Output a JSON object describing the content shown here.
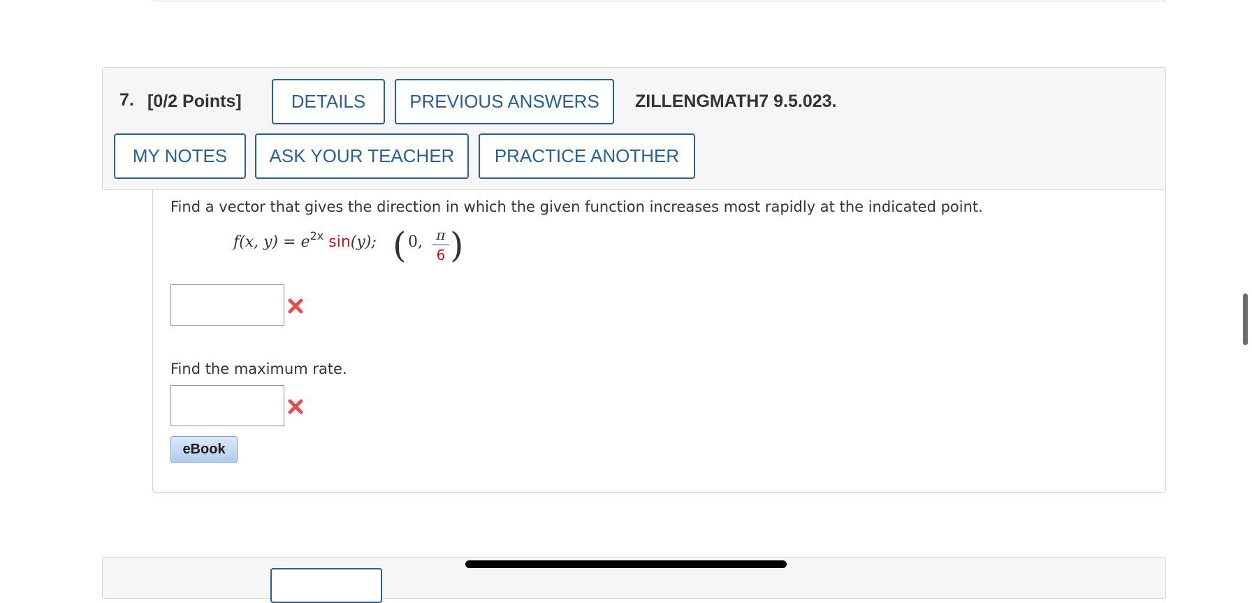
{
  "question": {
    "number": "7.",
    "points": "[0/2 Points]",
    "code": "ZILLENGMATH7 9.5.023.",
    "buttons": {
      "details": "DETAILS",
      "previous_answers": "PREVIOUS ANSWERS",
      "my_notes": "MY NOTES",
      "ask_teacher": "ASK YOUR TEACHER",
      "practice_another": "PRACTICE ANOTHER"
    },
    "prompt": "Find a vector that gives the direction in which the given function increases most rapidly at the indicated point.",
    "formula": {
      "lhs": "f(x, y)",
      "equals": "=",
      "base": "e",
      "exponent": "2x",
      "func": "sin",
      "arg": "(y);",
      "point_x": "0,",
      "point_y_num": "π",
      "point_y_den": "6"
    },
    "answer1": {
      "value": "",
      "status": "incorrect"
    },
    "second_prompt": "Find the maximum rate.",
    "answer2": {
      "value": "",
      "status": "incorrect"
    },
    "ebook_label": "eBook"
  },
  "colors": {
    "button_blue": "#2a5f8f",
    "incorrect_red": "#e05050",
    "math_red": "#c0141c",
    "header_bg": "#f6f6f6"
  },
  "icons": {
    "incorrect": "x-mark-icon"
  }
}
